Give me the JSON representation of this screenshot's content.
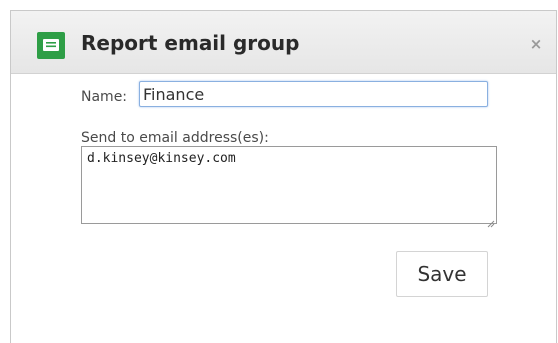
{
  "dialog": {
    "title": "Report email group",
    "close_label": "×"
  },
  "form": {
    "name_label": "Name:",
    "name_value": "Finance",
    "email_label": "Send to email address(es):",
    "email_value": "d.kinsey@kinsey.com",
    "save_label": "Save"
  },
  "icons": {
    "app_icon": "message-icon",
    "close_icon": "close-icon"
  },
  "colors": {
    "accent_green": "#2e9e46",
    "focus_blue": "#8ab0e0"
  }
}
